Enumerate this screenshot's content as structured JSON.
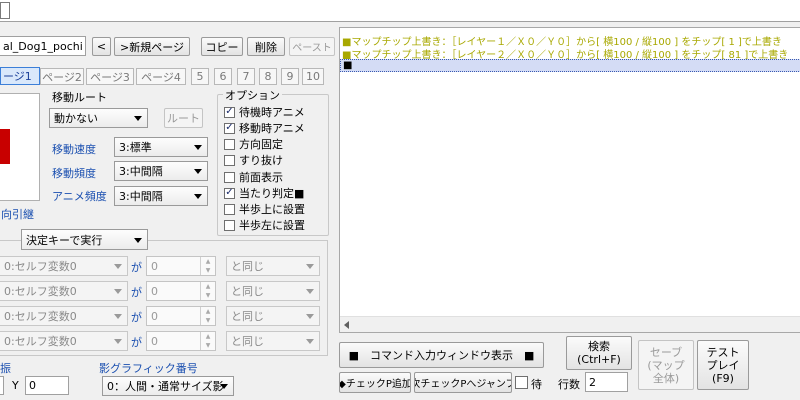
{
  "event_name": "al_Dog1_pochi",
  "nav": {
    "prev": "<",
    "new_page": ">新規ページ",
    "copy": "コピー",
    "delete": "削除",
    "paste": "ペースト"
  },
  "tabs": [
    "ージ1",
    "ページ2",
    "ページ3",
    "ページ4",
    "5",
    "6",
    "7",
    "8",
    "9",
    "10"
  ],
  "movement": {
    "route_label": "移動ルート",
    "route_value": "動かない",
    "route_button": "ルート",
    "speed_label": "移動速度",
    "speed_value": "3:標準",
    "freq_label": "移動頻度",
    "freq_value": "3:中間隔",
    "anim_label": "アニメ頻度",
    "anim_value": "3:中間隔"
  },
  "options": {
    "title": "オプション",
    "items": [
      {
        "label": "待機時アニメ",
        "mark": "✓"
      },
      {
        "label": "移動時アニメ",
        "mark": "✓"
      },
      {
        "label": "方向固定",
        "mark": ""
      },
      {
        "label": "すり抜け",
        "mark": ""
      },
      {
        "label": "前面表示",
        "mark": ""
      },
      {
        "label": "当たり判定■",
        "mark": "✓"
      },
      {
        "label": "半歩上に設置",
        "mark": ""
      },
      {
        "label": "半歩左に設置",
        "mark": ""
      }
    ]
  },
  "direction_caption": "向引継",
  "trigger": "決定キーで実行",
  "conditions": [
    {
      "var": "0:セルフ変数0",
      "ga": "が",
      "value": "0",
      "op": "と同じ"
    },
    {
      "var": "0:セルフ変数0",
      "ga": "が",
      "value": "0",
      "op": "と同じ"
    },
    {
      "var": "0:セルフ変数0",
      "ga": "が",
      "value": "0",
      "op": "と同じ"
    },
    {
      "var": "0:セルフ変数0",
      "ga": "が",
      "value": "0",
      "op": "と同じ"
    }
  ],
  "bottom": {
    "frag_label": "振",
    "y_label": "Y",
    "y_value": "0",
    "shadow_label": "影グラフィック番号",
    "shadow_value": "0：人間・通常サイズ影"
  },
  "commands": {
    "lines": [
      "■マップチップ上書き：［レイヤー１／Ｘ０／Ｙ０］から[ 横100 / 縦100 ] をチップ[ 1 ]で上書き",
      "■マップチップ上書き：［レイヤー２／Ｘ０／Ｙ０］から[ 横100 / 縦100 ] をチップ[ 81 ]で上書き",
      "■"
    ],
    "text_color": "#a8a800",
    "selected_bg": "#d4dcf5"
  },
  "actions": {
    "command_window": "■　コマンド入力ウィンドウ表示　■",
    "search_1": "検索",
    "search_2": "(Ctrl+F)",
    "save_1": "セーブ",
    "save_2": "(マップ",
    "save_3": "全体)",
    "test_1": "テスト",
    "test_2": "プレイ",
    "test_3": "(F9)",
    "checkpoint_add": "◆チェックP追加",
    "checkpoint_jump": "次チェックPへジャンプ",
    "wait_label": "待",
    "lines_label": "行数",
    "lines_value": "2"
  }
}
